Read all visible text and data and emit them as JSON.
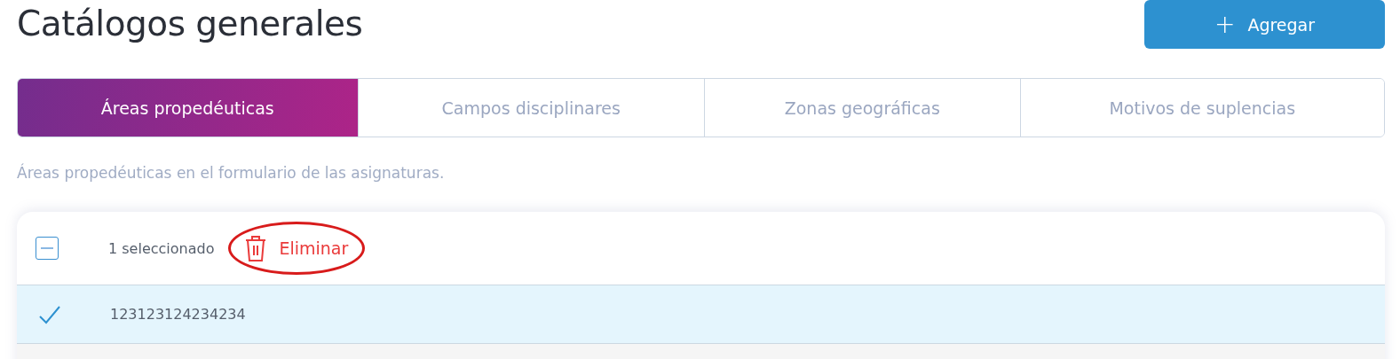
{
  "page_title": "Catálogos generales",
  "add_button": {
    "icon": "+",
    "label": "Agregar"
  },
  "tabs": [
    {
      "label": "Áreas propedéuticas",
      "selected": true
    },
    {
      "label": "Campos disciplinares",
      "selected": false
    },
    {
      "label": "Zonas geográficas",
      "selected": false
    },
    {
      "label": "Motivos de suplencias",
      "selected": false
    }
  ],
  "description": "Áreas propedéuticas en el formulario de las asignaturas.",
  "table": {
    "select_all": {
      "partial": true
    },
    "selection_count": "1 seleccionado",
    "delete_button": {
      "label": "Eliminar",
      "highlighted": true
    },
    "rows": [
      {
        "text": "123123124234234",
        "selected": true
      }
    ]
  }
}
